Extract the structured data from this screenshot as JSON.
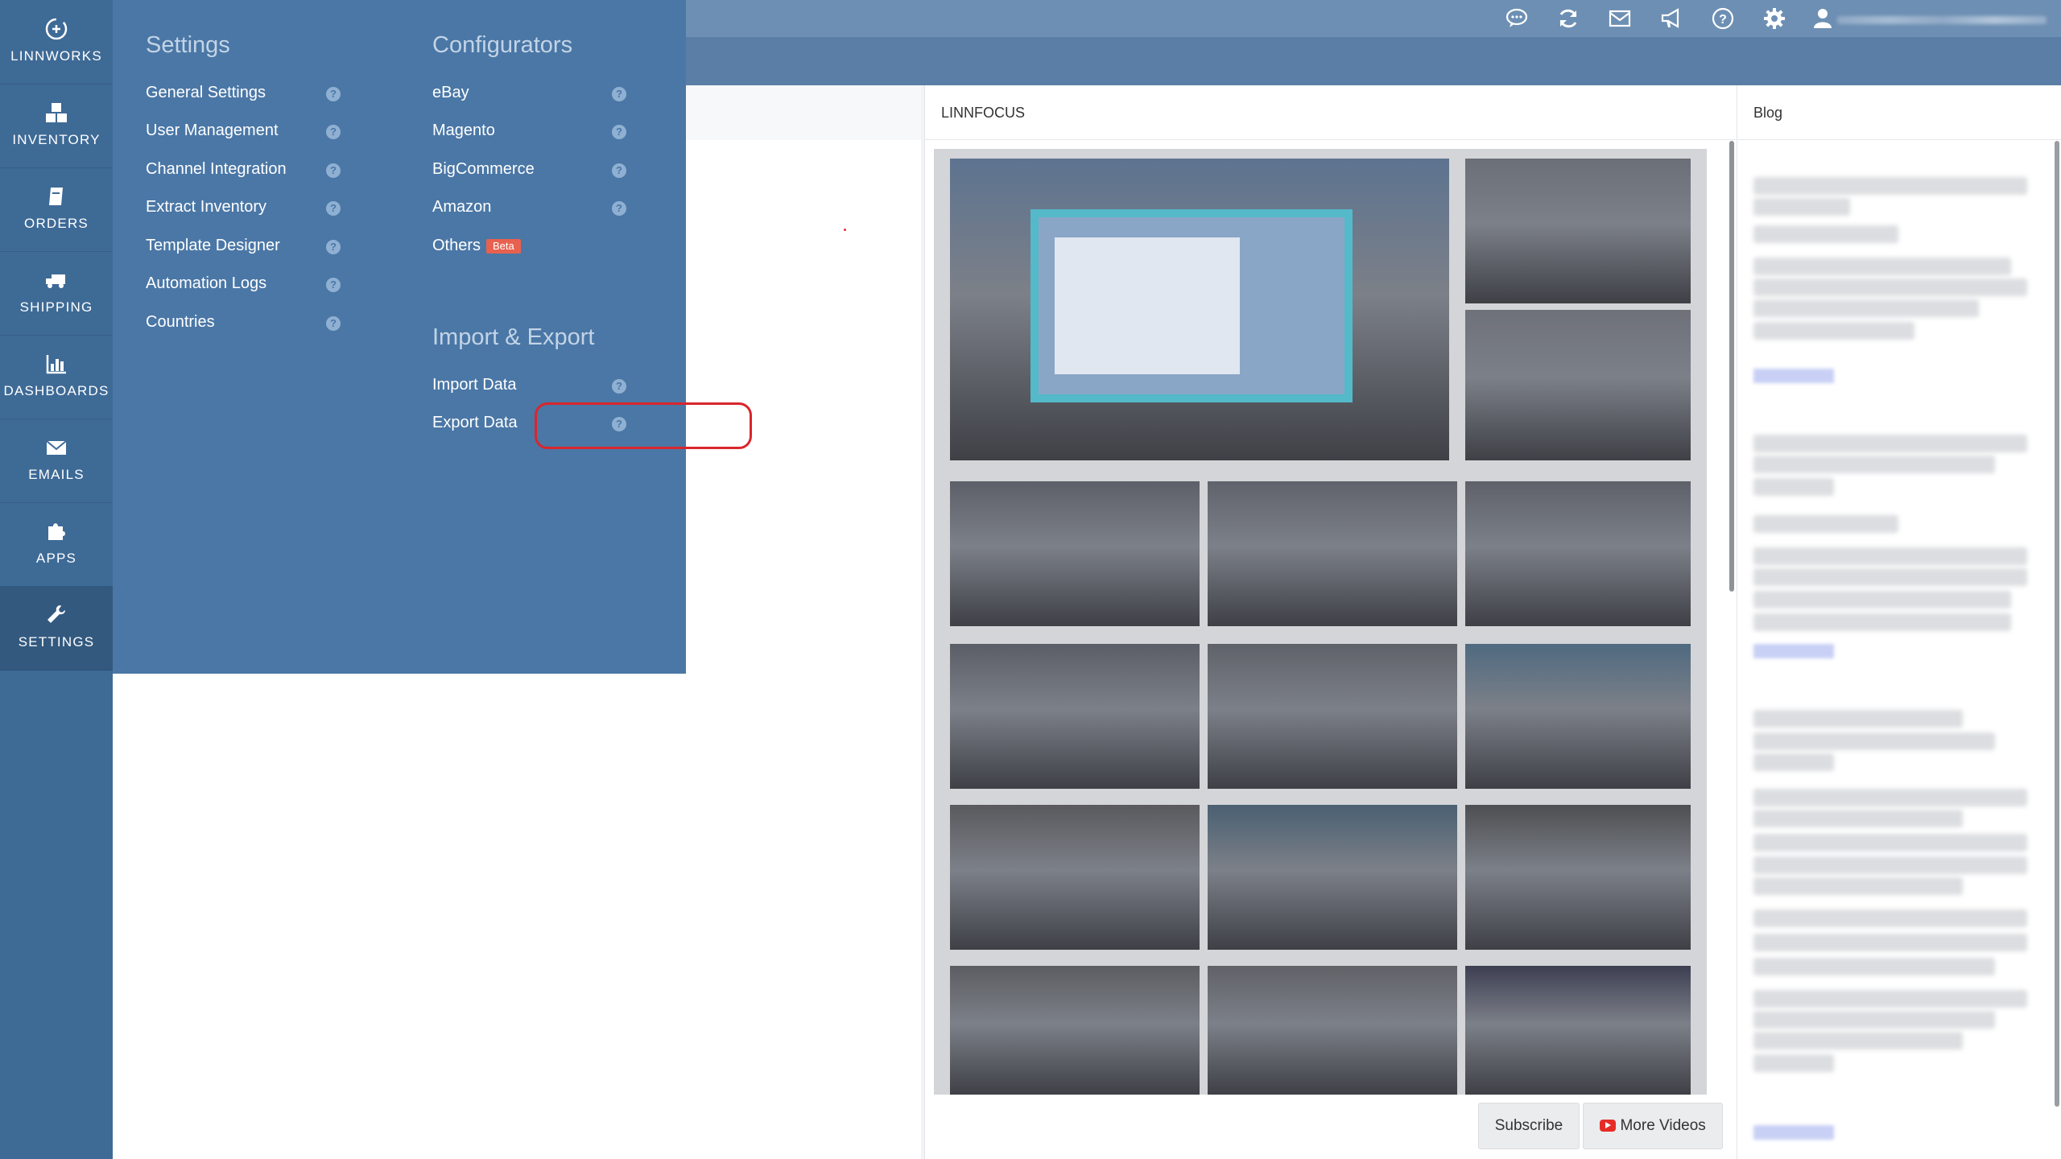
{
  "nav": {
    "items": [
      {
        "label": "LINNWORKS",
        "icon": "linnworks-logo-icon"
      },
      {
        "label": "INVENTORY",
        "icon": "boxes-icon"
      },
      {
        "label": "ORDERS",
        "icon": "orders-book-icon"
      },
      {
        "label": "SHIPPING",
        "icon": "truck-icon"
      },
      {
        "label": "DASHBOARDS",
        "icon": "bar-chart-icon"
      },
      {
        "label": "EMAILS",
        "icon": "envelope-icon"
      },
      {
        "label": "APPS",
        "icon": "puzzle-icon"
      },
      {
        "label": "SETTINGS",
        "icon": "wrench-icon"
      }
    ],
    "active": "SETTINGS"
  },
  "topbar": {
    "icons": [
      "chat-icon",
      "refresh-icon",
      "mail-icon",
      "megaphone-icon",
      "help-icon",
      "gear-icon",
      "user-icon"
    ]
  },
  "flyout": {
    "settings": {
      "heading": "Settings",
      "links": [
        "General Settings",
        "User Management",
        "Channel Integration",
        "Extract Inventory",
        "Template Designer",
        "Automation Logs",
        "Countries"
      ]
    },
    "configurators": {
      "heading": "Configurators",
      "links": [
        "eBay",
        "Magento",
        "BigCommerce",
        "Amazon",
        "Others"
      ],
      "beta_label": "Beta"
    },
    "import_export": {
      "heading": "Import & Export",
      "links": [
        "Import Data",
        "Export Data"
      ]
    },
    "help_glyph": "?"
  },
  "linnfocus": {
    "title": "LINNFOCUS",
    "subscribe_label": "Subscribe",
    "more_videos_label": "More Videos"
  },
  "blog": {
    "title": "Blog"
  },
  "colors": {
    "nav_bg": "#3e6a96",
    "flyout_bg": "#4a77a6",
    "topbar_bg": "#6d8fb3",
    "highlight": "#d9262c",
    "beta": "#e8614f"
  }
}
